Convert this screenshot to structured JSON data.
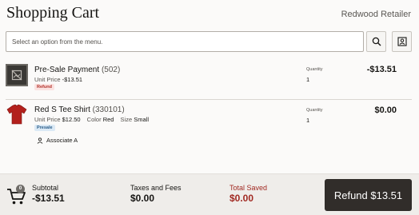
{
  "header": {
    "title": "Shopping Cart",
    "store": "Redwood Retailer"
  },
  "search": {
    "placeholder": "Select an option from the menu.",
    "search_icon": "search-icon",
    "scan_icon": "scan-person-icon"
  },
  "items": [
    {
      "name": "Pre-Sale Payment",
      "code": "(502)",
      "unit_price_label": "Unit Price",
      "unit_price": "-$13.51",
      "badge": "Refund",
      "quantity_label": "Quantity",
      "quantity": "1",
      "price": "-$13.51",
      "thumb_icon": "no-image-icon"
    },
    {
      "name": "Red S Tee Shirt",
      "code": "(330101)",
      "unit_price_label": "Unit Price",
      "unit_price": "$12.50",
      "color_label": "Color",
      "color": "Red",
      "size_label": "Size",
      "size": "Small",
      "badge": "Presale",
      "associate": "Associate A",
      "quantity_label": "Quantity",
      "quantity": "1",
      "price": "$0.00",
      "thumb_icon": "red-tshirt-image"
    }
  ],
  "footer": {
    "cart_count": "0",
    "subtotal_label": "Subtotal",
    "subtotal": "-$13.51",
    "taxes_label": "Taxes and Fees",
    "taxes": "$0.00",
    "saved_label": "Total Saved",
    "saved": "$0.00",
    "refund_button": "Refund $13.51"
  },
  "colors": {
    "refund_button_bg": "#312d2a",
    "saved_text": "#a12a23",
    "refund_badge_bg": "#fbe3e1",
    "presale_badge_bg": "#dbe9f5"
  }
}
